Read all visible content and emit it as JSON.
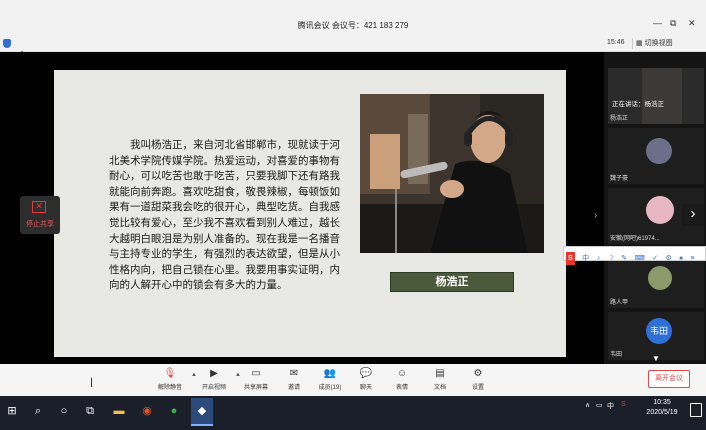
{
  "window": {
    "title": "腾讯会议 会议号：421 183 279",
    "controls": [
      "—",
      "⧉",
      "✕"
    ]
  },
  "infobar": {
    "time": "15:46",
    "view_switch": "切换视图"
  },
  "slide": {
    "paragraph": "我叫杨浩正，来自河北省邯郸市，现就读于河北美术学院传媒学院。热爱运动，对喜爱的事物有耐心，可以吃苦也敢于吃苦，只要我脚下还有路我就能向前奔跑。喜欢吃甜食，敬畏辣椒，每顿饭如果有一道甜菜我会吃的很开心，典型吃货。自我感觉比较有爱心，至少我不喜欢看到别人难过，越长大越明白眼泪是为别人准备的。现在我是一名播音与主持专业的学生，有强烈的表达欲望，但是从小性格内向，把自己锁在心里。我要用事实证明，内向的人解开心中的锁会有多大的力量。",
    "name": "杨浩正"
  },
  "stop_share": {
    "label": "停止共享"
  },
  "panel": {
    "speaking": "正在讲话：杨浩正",
    "participants": [
      {
        "name": "杨浩正"
      },
      {
        "name": "魏子豪"
      },
      {
        "name": "安徽(网吧)61974..."
      },
      {
        "name": "路人甲"
      },
      {
        "name": "韦田",
        "initials": "韦田"
      }
    ],
    "ime": [
      "中",
      "♪",
      "☽",
      "✎",
      "⌨",
      "✓",
      "⚙",
      "♠",
      "≡"
    ]
  },
  "toolbar": {
    "buttons": [
      {
        "label": "解除静音",
        "icon": "mic-muted-icon"
      },
      {
        "label": "开启视频",
        "icon": "video-off-icon"
      },
      {
        "label": "共享屏幕",
        "icon": "screen-share-icon"
      },
      {
        "label": "邀请",
        "icon": "invite-icon"
      },
      {
        "label": "成员(19)",
        "icon": "members-icon"
      },
      {
        "label": "聊天",
        "icon": "chat-icon"
      },
      {
        "label": "表情",
        "icon": "emoji-icon"
      },
      {
        "label": "文档",
        "icon": "document-icon"
      },
      {
        "label": "设置",
        "icon": "settings-icon"
      }
    ],
    "leave": "离开会议"
  },
  "taskbar": {
    "tray_lang": "中",
    "time": "10:35",
    "date": "2020/5/19"
  },
  "colors": {
    "accent": "#2d6fd6",
    "danger": "#e04b4b",
    "name_plate": "#4b5a3c"
  }
}
